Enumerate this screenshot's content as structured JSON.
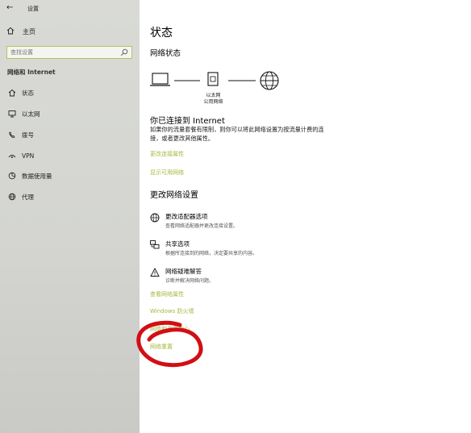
{
  "window": {
    "title": "设置",
    "back_icon": "back-arrow-icon"
  },
  "sidebar": {
    "home_label": "主页",
    "search_placeholder": "查找设置",
    "section_header": "网络和 Internet",
    "items": [
      {
        "label": "状态",
        "icon": "home-status-icon"
      },
      {
        "label": "以太网",
        "icon": "monitor-icon"
      },
      {
        "label": "拨号",
        "icon": "phone-icon"
      },
      {
        "label": "VPN",
        "icon": "vpn-icon"
      },
      {
        "label": "数据使用量",
        "icon": "pie-icon"
      },
      {
        "label": "代理",
        "icon": "globe-icon"
      }
    ]
  },
  "main": {
    "title": "状态",
    "network_status_header": "网络状态",
    "diagram": {
      "adapter_label_1": "以太网",
      "adapter_label_2": "公用网络"
    },
    "connected_title": "你已连接到 Internet",
    "connected_desc": "如果你的流量套餐有限制，则你可以将此网络设置为按流量计费的连接，或者更改其他属性。",
    "link_change_props": "更改连接属性",
    "link_show_networks": "显示可用网络",
    "change_header": "更改网络设置",
    "options": [
      {
        "title": "更改适配器选项",
        "desc": "查看网络适配器并更改连接设置。",
        "icon": "adapter-globe-icon"
      },
      {
        "title": "共享选项",
        "desc": "根据所连接到的网络，决定要共享的内容。",
        "icon": "share-computers-icon"
      },
      {
        "title": "网络疑难解答",
        "desc": "诊断并解决网络问题。",
        "icon": "warning-icon"
      }
    ],
    "link_view_props": "查看网络属性",
    "link_firewall": "Windows 防火墙",
    "link_sharing_center": "网络和共享中心",
    "link_reset": "网络重置"
  },
  "colors": {
    "sidebar_bg": "#d4d5d1",
    "accent_link": "#a5b83c",
    "search_border": "#b5c35e",
    "annotation": "#d10f14"
  }
}
